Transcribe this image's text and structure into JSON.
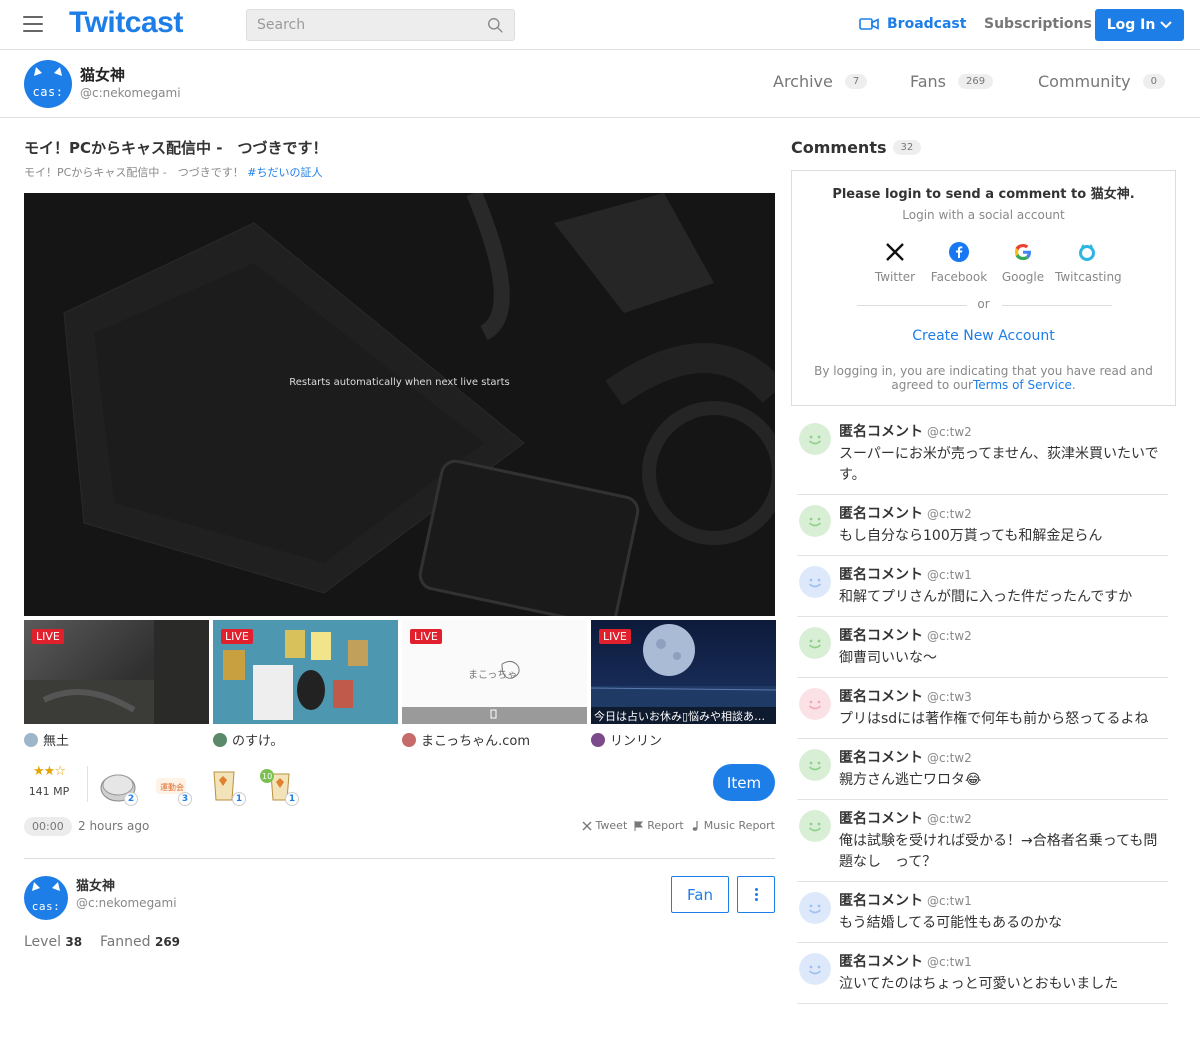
{
  "nav": {
    "logo": "Twitcast",
    "search_placeholder": "Search",
    "broadcast": "Broadcast",
    "subscriptions": "Subscriptions",
    "login": "Log In"
  },
  "channel": {
    "avatar_text": "cas:",
    "name": "猫女神",
    "id": "@c:nekomegami",
    "tabs": [
      {
        "label": "Archive",
        "count": "7"
      },
      {
        "label": "Fans",
        "count": "269"
      },
      {
        "label": "Community",
        "count": "0"
      }
    ]
  },
  "stream": {
    "title": "モイ！PCからキャス配信中 -　つづきです！",
    "subtitle": "モイ！PCからキャス配信中 -　つづきです！",
    "hashtag": "#ちだいの証人",
    "player_message": "Restarts automatically when next live starts"
  },
  "related": [
    {
      "live": "LIVE",
      "caption": "",
      "owner": "無土",
      "color": "#4a4a4a"
    },
    {
      "live": "LIVE",
      "caption": "",
      "owner": "のすけ。",
      "color": "#3b8ea8"
    },
    {
      "live": "LIVE",
      "caption": "",
      "owner": "まこっちゃん.com",
      "color": "#f7f7f7"
    },
    {
      "live": "LIVE",
      "caption": "今日は占いお休み▯悩みや相談ある方どうぞ！",
      "owner": "リンリン",
      "color": "#1a2a4e"
    }
  ],
  "items": {
    "mp_label": "141 MP",
    "gifts": [
      {
        "name": "silver-coin",
        "count": "2"
      },
      {
        "name": "sticker",
        "count": "3"
      },
      {
        "name": "cup",
        "count": "1"
      },
      {
        "name": "cup-10",
        "count": "1"
      }
    ],
    "item_button": "Item"
  },
  "meta": {
    "time": "00:00",
    "ago": "2 hours ago",
    "tweet": "Tweet",
    "report": "Report",
    "music": "Music Report"
  },
  "owner": {
    "name": "猫女神",
    "id": "@c:nekomegami",
    "fan_button": "Fan",
    "level_label": "Level",
    "level": "38",
    "fanned_label": "Fanned",
    "fanned": "269"
  },
  "comments": {
    "title": "Comments",
    "count": "32",
    "login_title": "Please login to send a comment to 猫女神.",
    "login_sub": "Login with a social account",
    "socials": [
      {
        "label": "Twitter",
        "icon": "x-icon"
      },
      {
        "label": "Facebook",
        "icon": "facebook-icon"
      },
      {
        "label": "Google",
        "icon": "google-icon"
      },
      {
        "label": "Twitcasting",
        "icon": "twitcasting-icon"
      }
    ],
    "or": "or",
    "create": "Create New Account",
    "terms_prefix": "By logging in, you are indicating that you have read and agreed to our",
    "terms_link": "Terms of Service",
    "terms_suffix": ".",
    "list": [
      {
        "name": "匿名コメント",
        "id": "@c:tw2",
        "text": "スーパーにお米が売ってません、荻津米買いたいです。",
        "color": "#8fd18a"
      },
      {
        "name": "匿名コメント",
        "id": "@c:tw2",
        "text": "もし自分なら100万貰っても和解金足らん",
        "color": "#8fd18a"
      },
      {
        "name": "匿名コメント",
        "id": "@c:tw1",
        "text": "和解てプリさんが間に入った件だったんですか",
        "color": "#9fc0f0"
      },
      {
        "name": "匿名コメント",
        "id": "@c:tw2",
        "text": "御曹司いいな〜",
        "color": "#8fd18a"
      },
      {
        "name": "匿名コメント",
        "id": "@c:tw3",
        "text": "プリはsdには著作権で何年も前から怒ってるよね",
        "color": "#f2a9b8"
      },
      {
        "name": "匿名コメント",
        "id": "@c:tw2",
        "text": "親方さん逃亡ワロタ😂",
        "color": "#8fd18a"
      },
      {
        "name": "匿名コメント",
        "id": "@c:tw2",
        "text": "俺は試験を受ければ受かる！→合格者名乗っても問題なし　って？",
        "color": "#8fd18a"
      },
      {
        "name": "匿名コメント",
        "id": "@c:tw1",
        "text": "もう結婚してる可能性もあるのかな",
        "color": "#9fc0f0"
      },
      {
        "name": "匿名コメント",
        "id": "@c:tw1",
        "text": "泣いてたのはちょっと可愛いとおもいました",
        "color": "#9fc0f0"
      }
    ]
  }
}
